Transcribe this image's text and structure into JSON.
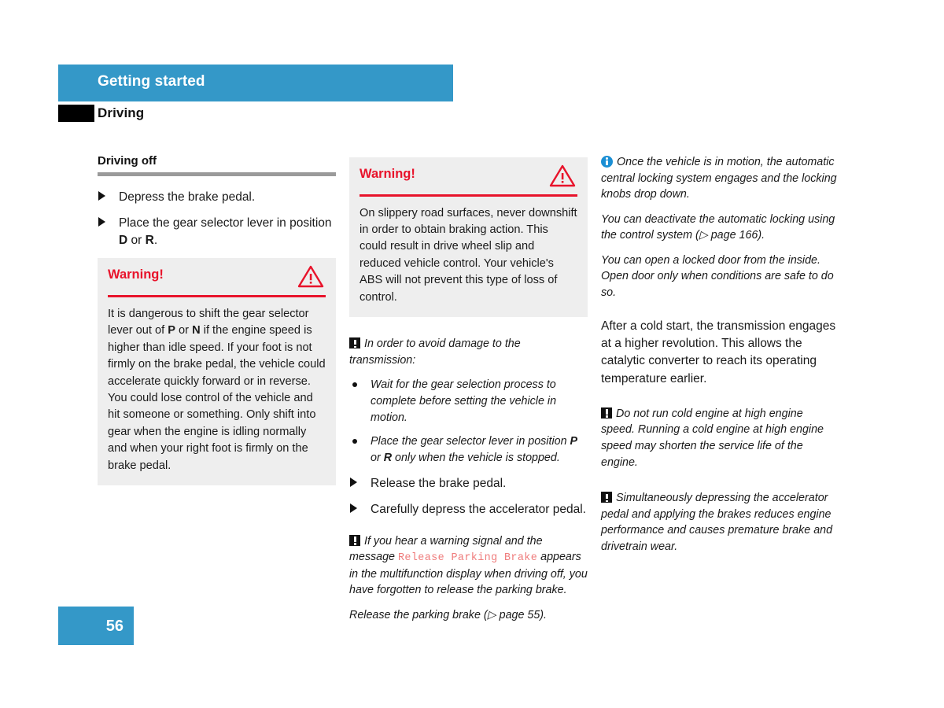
{
  "header": {
    "chapter_title": "Getting started",
    "section_title": "Driving",
    "bar_color": "#3498c8",
    "block_color": "#000000"
  },
  "column_1": {
    "subheading": "Driving off",
    "steps": [
      {
        "text_before": "Depress the brake pedal.",
        "bold": "",
        "text_after": ""
      },
      {
        "text_before": "Place the gear selector lever in position ",
        "bold": "D",
        "mid": " or ",
        "bold2": "R",
        "text_after": "."
      }
    ],
    "warning": {
      "title": "Warning!",
      "icon": "warning-triangle-icon",
      "accent_color": "#e8132b",
      "body_part_1": "It is dangerous to shift the gear selector lever out of ",
      "body_bold_1": "P",
      "body_part_2": " or ",
      "body_bold_2": "N",
      "body_part_3": " if the engine speed is higher than idle speed. If your foot is not firmly on the brake pedal, the vehicle could accelerate quickly forward or in reverse. You could lose control of the vehicle and hit someone or something. Only shift into gear when the engine is idling normally and when your right foot is firmly on the brake pedal."
    }
  },
  "column_2": {
    "warning": {
      "title": "Warning!",
      "icon": "warning-triangle-icon",
      "accent_color": "#e8132b",
      "body": "On slippery road surfaces, never downshift in order to obtain braking action. This could result in drive wheel slip and reduced vehicle control. Your vehicle's ABS will not prevent this type of loss of control."
    },
    "caution_note": {
      "icon": "caution-icon",
      "text": "In order to avoid damage to the transmission:"
    },
    "bullets": [
      {
        "part_1": "Wait for the gear selection process to complete before setting the vehicle in motion.",
        "bold": "",
        "part_2": ""
      },
      {
        "part_1": "Place the gear selector lever in position ",
        "bold": "P",
        "part_2": " or ",
        "bold2": "R",
        "part_3": " only when the vehicle is stopped."
      }
    ],
    "steps": [
      {
        "text": "Release the brake pedal."
      },
      {
        "text": "Carefully depress the accelerator pedal."
      }
    ],
    "caution_note_2": {
      "icon": "caution-icon",
      "part_1": "If you hear a warning signal and the message ",
      "display_message": "Release Parking Brake",
      "message_color": "#ef7b7b",
      "part_2": " appears in the multifunction display when driving off, you have forgotten to release the parking brake."
    },
    "cross_reference": {
      "text_before": "Release the parking brake (",
      "arrow": "▷",
      "text_after": " page 55)."
    }
  },
  "column_3": {
    "info_note": {
      "icon": "info-icon",
      "icon_color": "#1b8fd4",
      "text": "Once the vehicle is in motion, the automatic central locking system engages and the locking knobs drop down."
    },
    "info_paragraph_2": {
      "text_before": "You can deactivate the automatic locking using the control system (",
      "arrow": "▷",
      "text_after": " page 166)."
    },
    "info_paragraph_3": "You can open a locked door from the inside. Open door only when conditions are safe to do so.",
    "plain_paragraph": "After a cold start, the transmission engages at a higher revolution. This allows the catalytic converter to reach its operating temperature earlier.",
    "caution_note_1": {
      "icon": "caution-icon",
      "text": "Do not run cold engine at high engine speed. Running a cold engine at high engine speed may shorten the service life of the engine."
    },
    "caution_note_2": {
      "icon": "caution-icon",
      "text": "Simultaneously depressing the accelerator pedal and applying the brakes reduces engine performance and causes premature brake and drivetrain wear."
    }
  },
  "footer": {
    "page_number": "56",
    "badge_color": "#3498c8"
  }
}
